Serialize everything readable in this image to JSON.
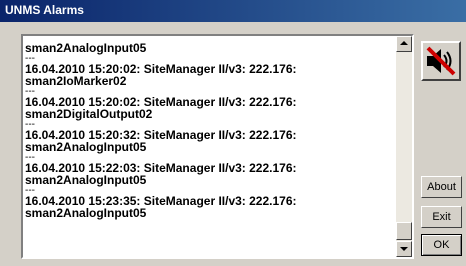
{
  "window": {
    "title": "UNMS Alarms"
  },
  "alarm_log": {
    "lines": [
      "sman2AnalogInput05",
      "---",
      "16.04.2010 15:20:02: SiteManager II/v3: 222.176:",
      "sman2IoMarker02",
      "---",
      "16.04.2010 15:20:02: SiteManager II/v3: 222.176:",
      "sman2DigitalOutput02",
      "---",
      "16.04.2010 15:20:32: SiteManager II/v3: 222.176:",
      "sman2AnalogInput05",
      "---",
      "16.04.2010 15:22:03: SiteManager II/v3: 222.176:",
      "sman2AnalogInput05",
      "---",
      "16.04.2010 15:23:35: SiteManager II/v3: 222.176:",
      "sman2AnalogInput05"
    ]
  },
  "buttons": {
    "about": "About",
    "exit": "Exit",
    "ok": "OK"
  },
  "icons": {
    "mute": "speaker-muted-icon"
  },
  "colors": {
    "titlebar_start": "#0a246a",
    "titlebar_end": "#3a6ea5",
    "mute_cross": "#cc0000"
  }
}
